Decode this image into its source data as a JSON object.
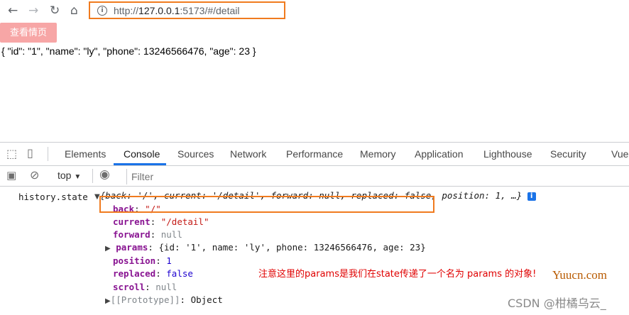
{
  "browser": {
    "url_scheme": "http://",
    "url_host": "127.0.0.1",
    "url_rest": ":5173/#/detail",
    "nav_icons": [
      "back-arrow-icon",
      "forward-arrow-icon",
      "reload-icon",
      "home-icon"
    ]
  },
  "page": {
    "button_label": "查看情页",
    "detail_json": "{ \"id\": \"1\", \"name\": \"ly\", \"phone\": 13246566476, \"age\": 23 }"
  },
  "devtools": {
    "tabs": [
      "Elements",
      "Console",
      "Sources",
      "Network",
      "Performance",
      "Memory",
      "Application",
      "Lighthouse",
      "Security",
      "Vue"
    ],
    "active_tab": "Console",
    "context": "top",
    "filter_placeholder": "Filter"
  },
  "console": {
    "label": "history.state",
    "summary": "{back: '/', current: '/detail', forward: null, replaced: false, position: 1, …}",
    "props": {
      "back_key": "back",
      "back_val": "\"/\"",
      "current_key": "current",
      "current_val": "\"/detail\"",
      "forward_key": "forward",
      "forward_val": "null",
      "params_key": "params",
      "params_val": "{id: '1', name: 'ly', phone: 13246566476, age: 23}",
      "position_key": "position",
      "position_val": "1",
      "replaced_key": "replaced",
      "replaced_val": "false",
      "scroll_key": "scroll",
      "scroll_val": "null",
      "proto_key": "[[Prototype]]",
      "proto_val": "Object"
    }
  },
  "annotation": "注意这里的params是我们在state传递了一个名为 params 的对象!",
  "watermarks": {
    "site": "Yuucn.com",
    "author": "CSDN @柑橘乌云_"
  },
  "colors": {
    "highlight_border": "#f07b1f",
    "button_bg": "#f7a6a6",
    "annotation": "#e00000",
    "active_tab_underline": "#1a73e8"
  }
}
